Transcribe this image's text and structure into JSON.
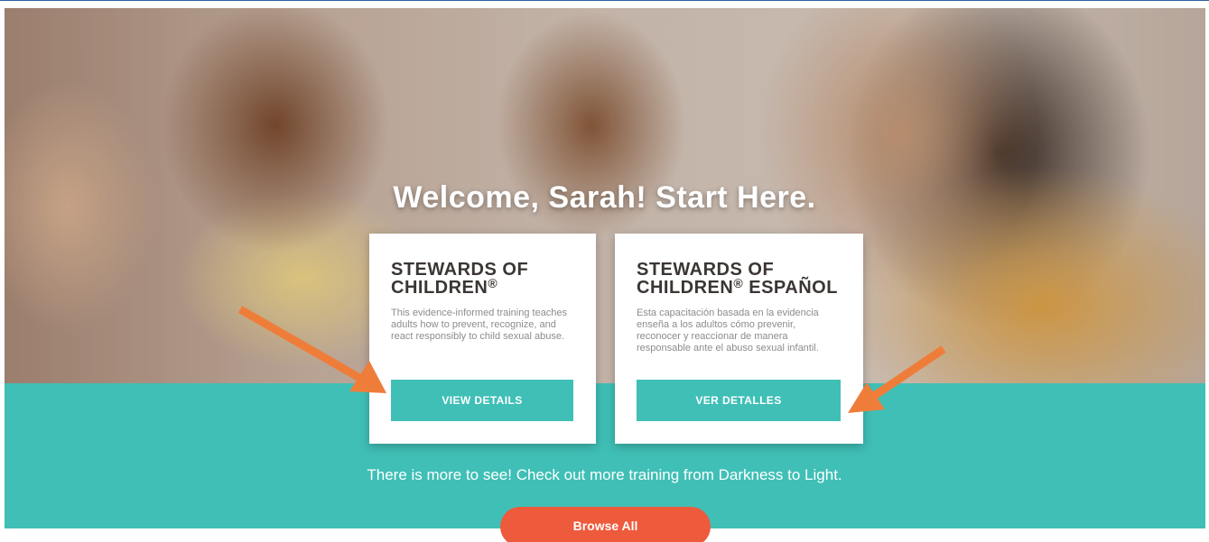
{
  "hero": {
    "welcome": "Welcome, Sarah! Start Here."
  },
  "cards": [
    {
      "title_line1": "STEWARDS OF",
      "title_line2": "CHILDREN",
      "title_mark": "®",
      "title_suffix": "",
      "description": "This evidence-informed training teaches adults how to prevent, recognize, and react responsibly to child sexual abuse.",
      "button": "VIEW DETAILS"
    },
    {
      "title_line1": "STEWARDS OF",
      "title_line2": "CHILDREN",
      "title_mark": "®",
      "title_suffix": " ESPAÑOL",
      "description": "Esta capacitación basada en la evidencia enseña a los adultos cómo prevenir, reconocer y reaccionar de manera responsable ante el abuso sexual infantil.",
      "button": "VER DETALLES"
    }
  ],
  "more_text": "There is more to see! Check out more training from Darkness to Light.",
  "browse_button": "Browse All",
  "colors": {
    "teal": "#3fbfb6",
    "orange_button": "#ee5a3c",
    "arrow": "#ef7d3a",
    "title_text": "#3b3634"
  }
}
